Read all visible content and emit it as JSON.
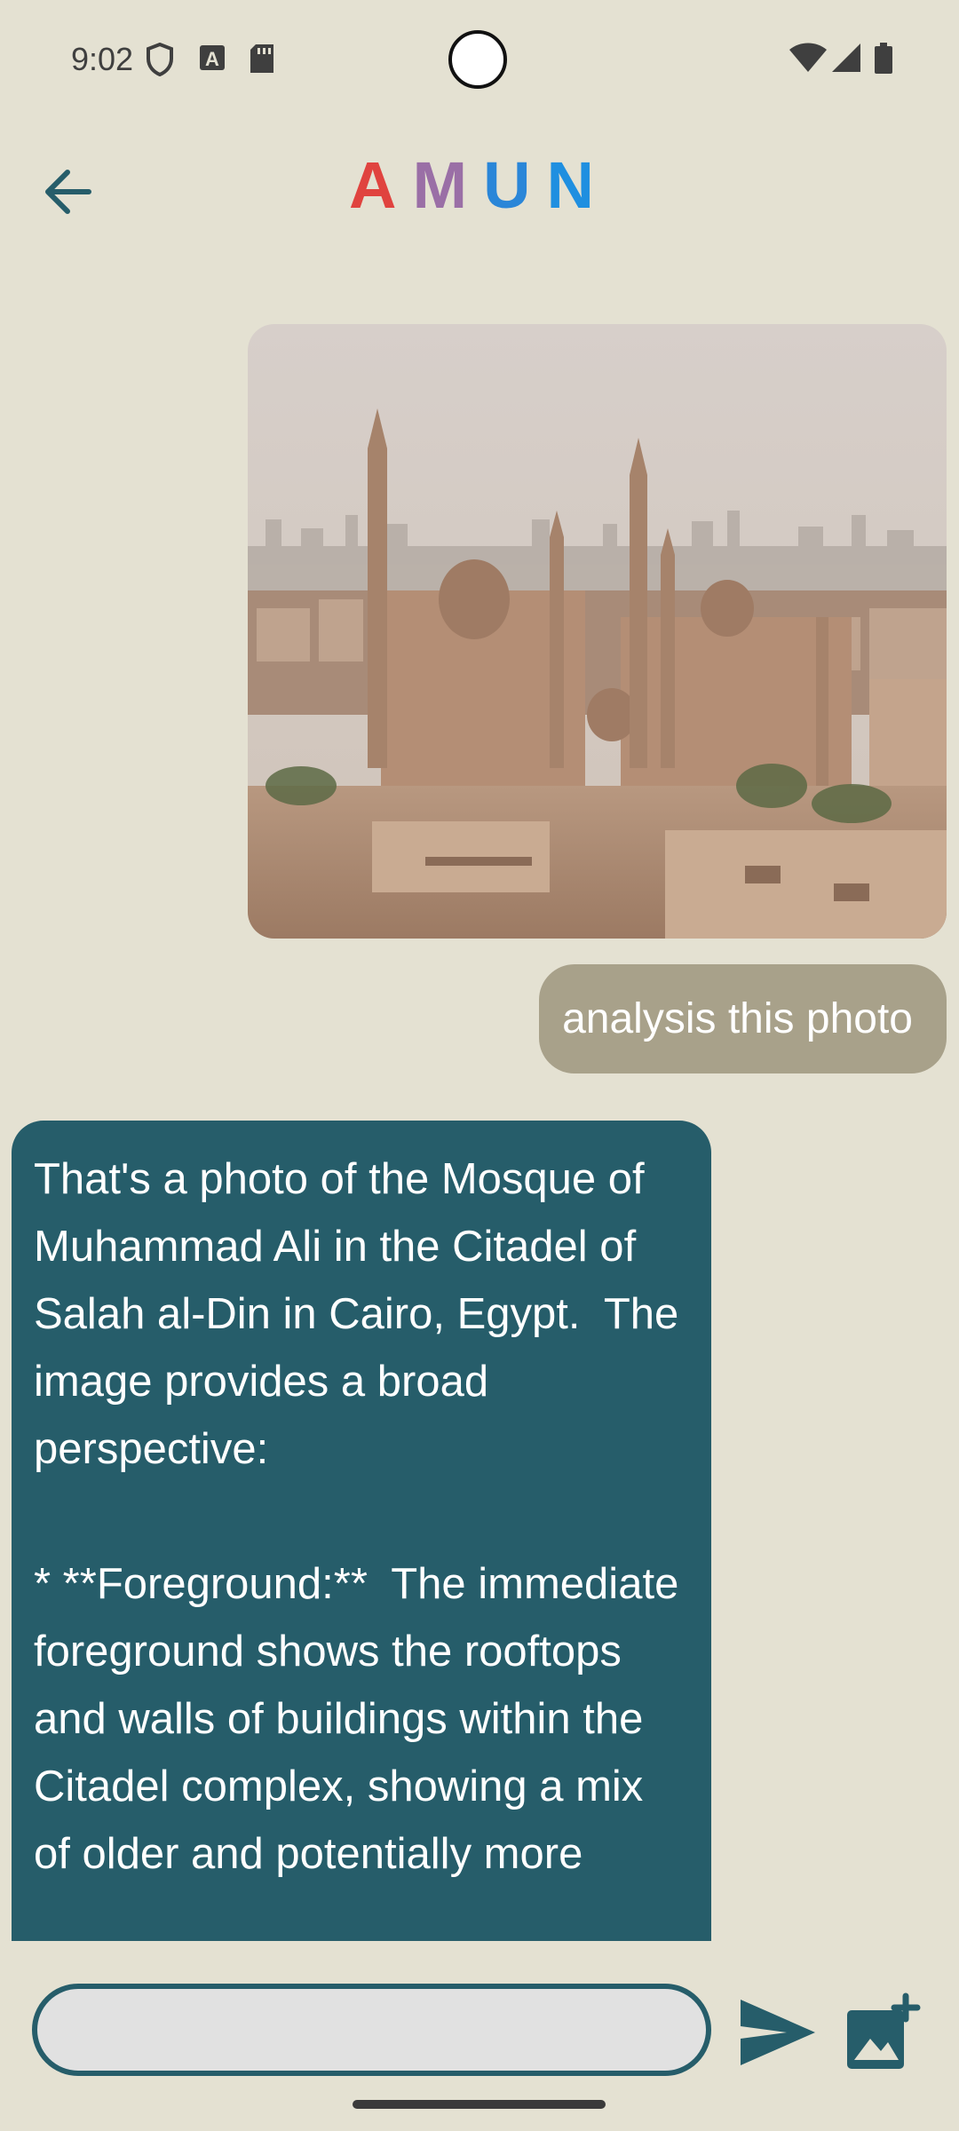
{
  "status_bar": {
    "time": "9:02",
    "icons": [
      "shield-icon",
      "text-a-icon",
      "sd-card-icon",
      "wifi-icon",
      "cell-signal-icon",
      "battery-icon"
    ]
  },
  "header": {
    "title": "AMUN",
    "title_colors": [
      "#e0433f",
      "#9a6fa6",
      "#2a86d8",
      "#1f8fe0"
    ],
    "back_icon": "arrow-back-icon"
  },
  "chat": {
    "sent_image_desc_icon": "mosque-photo",
    "sent_message": "analysis this photo",
    "reply_message": "That's a photo of the Mosque of Muhammad Ali in the Citadel of Salah al-Din in Cairo, Egypt.  The image provides a broad perspective:\n\n* **Foreground:**  The immediate foreground shows the rooftops and walls of buildings within the Citadel complex, showing a mix of older and potentially more"
  },
  "input": {
    "placeholder": "",
    "value": "",
    "send_icon": "send-icon",
    "add_image_icon": "add-photo-icon"
  },
  "colors": {
    "background": "#e4e1d2",
    "accent": "#265d6a",
    "sent_bubble": "#a8a18a"
  }
}
